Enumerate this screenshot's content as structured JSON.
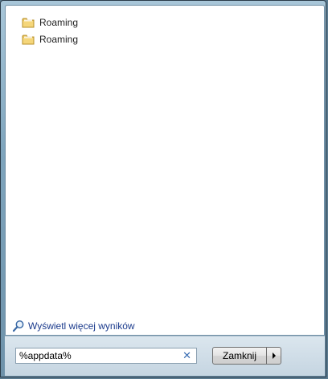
{
  "results": {
    "items": [
      {
        "label": "Roaming",
        "icon": "folder-icon"
      },
      {
        "label": "Roaming",
        "icon": "folder-icon"
      }
    ]
  },
  "more_results": {
    "label": "Wyświetl więcej wyników",
    "icon": "search-icon"
  },
  "search": {
    "value": "%appdata%",
    "clear_icon": "close-icon"
  },
  "shutdown": {
    "label": "Zamknij",
    "arrow_icon": "chevron-right-icon"
  },
  "colors": {
    "link": "#1a3a8c",
    "folder": "#e8c35a",
    "clear": "#3c6fb4"
  }
}
